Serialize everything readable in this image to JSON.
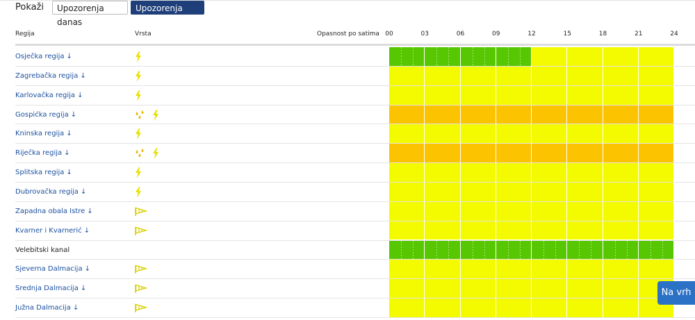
{
  "filter": {
    "label": "Pokaži",
    "tabs": [
      {
        "label": "Upozorenja danas",
        "active": false
      },
      {
        "label": "Upozorenja sutra",
        "active": true
      }
    ]
  },
  "table": {
    "headers": {
      "region": "Regija",
      "type": "Vrsta",
      "danger": "Opasnost po satima"
    },
    "hour_ticks": [
      "00",
      "03",
      "06",
      "09",
      "12",
      "15",
      "18",
      "21",
      "24"
    ],
    "colors": {
      "green": "#56c700",
      "yellow": "#f4fa00",
      "orange": "#fcc300"
    },
    "rows": [
      {
        "name": "Osječka regija",
        "link": true,
        "icons": [
          "thunder-icon"
        ],
        "levels": [
          "green",
          "green",
          "green",
          "green",
          "yellow",
          "yellow",
          "yellow",
          "yellow"
        ]
      },
      {
        "name": "Zagrebačka regija",
        "link": true,
        "icons": [
          "thunder-icon"
        ],
        "levels": [
          "yellow",
          "yellow",
          "yellow",
          "yellow",
          "yellow",
          "yellow",
          "yellow",
          "yellow"
        ]
      },
      {
        "name": "Karlovačka regija",
        "link": true,
        "icons": [
          "thunder-icon"
        ],
        "levels": [
          "yellow",
          "yellow",
          "yellow",
          "yellow",
          "yellow",
          "yellow",
          "yellow",
          "yellow"
        ]
      },
      {
        "name": "Gospićka regija",
        "link": true,
        "icons": [
          "rain-icon",
          "thunder-icon"
        ],
        "levels": [
          "orange",
          "orange",
          "orange",
          "orange",
          "orange",
          "orange",
          "orange",
          "orange"
        ]
      },
      {
        "name": "Kninska regija",
        "link": true,
        "icons": [
          "thunder-icon"
        ],
        "levels": [
          "yellow",
          "yellow",
          "yellow",
          "yellow",
          "yellow",
          "yellow",
          "yellow",
          "yellow"
        ]
      },
      {
        "name": "Riječka regija",
        "link": true,
        "icons": [
          "rain-icon",
          "thunder-icon"
        ],
        "levels": [
          "orange",
          "orange",
          "orange",
          "orange",
          "orange",
          "orange",
          "orange",
          "orange"
        ]
      },
      {
        "name": "Splitska regija",
        "link": true,
        "icons": [
          "thunder-icon"
        ],
        "levels": [
          "yellow",
          "yellow",
          "yellow",
          "yellow",
          "yellow",
          "yellow",
          "yellow",
          "yellow"
        ]
      },
      {
        "name": "Dubrovačka regija",
        "link": true,
        "icons": [
          "thunder-icon"
        ],
        "levels": [
          "yellow",
          "yellow",
          "yellow",
          "yellow",
          "yellow",
          "yellow",
          "yellow",
          "yellow"
        ]
      },
      {
        "name": "Zapadna obala Istre",
        "link": true,
        "icons": [
          "wind-icon"
        ],
        "levels": [
          "yellow",
          "yellow",
          "yellow",
          "yellow",
          "yellow",
          "yellow",
          "yellow",
          "yellow"
        ]
      },
      {
        "name": "Kvarner i Kvarnerić",
        "link": true,
        "icons": [
          "wind-icon"
        ],
        "levels": [
          "yellow",
          "yellow",
          "yellow",
          "yellow",
          "yellow",
          "yellow",
          "yellow",
          "yellow"
        ]
      },
      {
        "name": "Velebitski kanal",
        "link": false,
        "icons": [],
        "levels": [
          "green",
          "green",
          "green",
          "green",
          "green",
          "green",
          "green",
          "green"
        ]
      },
      {
        "name": "Sjeverna Dalmacija",
        "link": true,
        "icons": [
          "wind-icon"
        ],
        "levels": [
          "yellow",
          "yellow",
          "yellow",
          "yellow",
          "yellow",
          "yellow",
          "yellow",
          "yellow"
        ]
      },
      {
        "name": "Srednja Dalmacija",
        "link": true,
        "icons": [
          "wind-icon"
        ],
        "levels": [
          "yellow",
          "yellow",
          "yellow",
          "yellow",
          "yellow",
          "yellow",
          "yellow",
          "yellow"
        ]
      },
      {
        "name": "Južna Dalmacija",
        "link": true,
        "icons": [
          "wind-icon"
        ],
        "levels": [
          "yellow",
          "yellow",
          "yellow",
          "yellow",
          "yellow",
          "yellow",
          "yellow",
          "yellow"
        ]
      }
    ]
  },
  "back_to_top": "Na vrh"
}
